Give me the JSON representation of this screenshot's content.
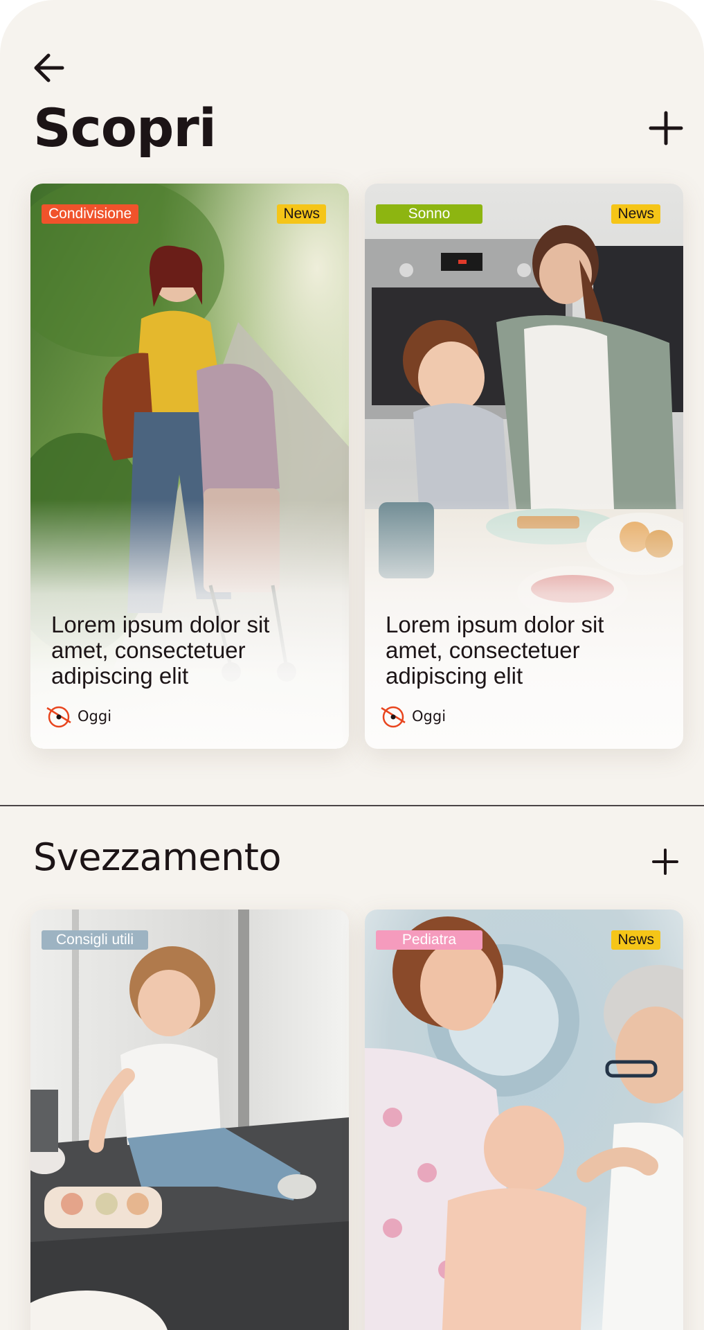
{
  "header": {
    "title": "Scopri",
    "back_icon": "arrow-left-icon",
    "add_icon": "plus-icon"
  },
  "feed": {
    "cards": [
      {
        "category": "Condivisione",
        "category_color": "#f0532b",
        "badge": "News",
        "title": "Lorem ipsum dolor sit amet, consectetuer adipiscing elit",
        "date": "Oggi",
        "date_icon": "clock-icon"
      },
      {
        "category": "Sonno",
        "category_color": "#8db511",
        "badge": "News",
        "title": "Lorem ipsum dolor sit amet, consectetuer adipiscing elit",
        "date": "Oggi",
        "date_icon": "clock-icon"
      }
    ]
  },
  "section": {
    "title": "Svezzamento",
    "add_icon": "plus-icon",
    "cards": [
      {
        "category": "Consigli utili",
        "category_color": "#9db3c2"
      },
      {
        "category": "Pediatra",
        "category_color": "#f59bbd",
        "badge": "News"
      }
    ]
  },
  "colors": {
    "background": "#f6f3ee",
    "news_badge": "#f5c518",
    "clock_accent": "#e8451e",
    "text": "#1c1416"
  }
}
